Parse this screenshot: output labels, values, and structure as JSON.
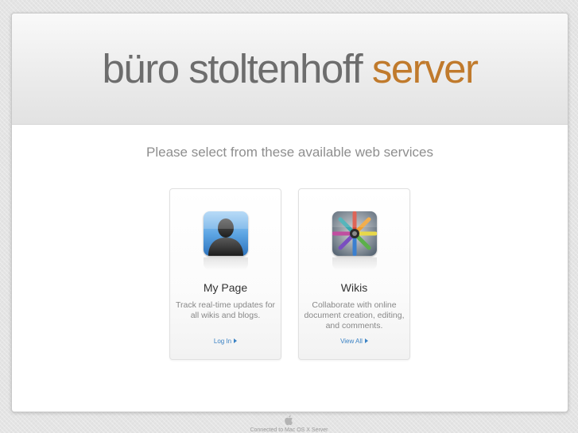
{
  "header": {
    "title_main": "büro stoltenhoff",
    "title_accent": "server"
  },
  "intro": {
    "subtitle": "Please select from these available web services"
  },
  "services": [
    {
      "title": "My Page",
      "description": "Track real-time updates for all wikis and blogs.",
      "link_label": "Log In",
      "icon": "user-silhouette-icon"
    },
    {
      "title": "Wikis",
      "description": "Collaborate with online document creation, editing, and comments.",
      "link_label": "View All",
      "icon": "pencils-icon"
    }
  ],
  "footer": {
    "text": "Connected to Mac OS X Server",
    "icon": "apple-logo-icon"
  },
  "colors": {
    "title_main": "#6d6d6d",
    "title_accent": "#c07a2c",
    "link": "#3a82c4"
  }
}
